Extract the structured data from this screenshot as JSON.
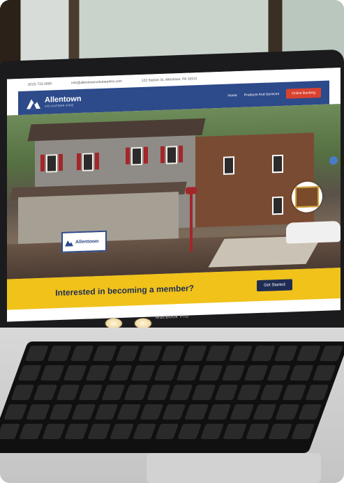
{
  "site": {
    "contact": {
      "phone": "(610) 733-2600",
      "email": "info@allentownvolunteerfire.com",
      "address": "123 Station St, Allentown, PA 18101"
    },
    "logo": {
      "title": "Allentown",
      "subtitle": "VOLUNTEER FIRE"
    },
    "nav": {
      "items": [
        "Home",
        "Products And Services"
      ],
      "cta": "Online Banking"
    },
    "sign_text": "Allentown",
    "banner": {
      "text": "Interested in becoming a member?",
      "button": "Get Started"
    }
  },
  "device": {
    "brand": "MacBook Pro"
  },
  "colors": {
    "nav": "#2d4a8a",
    "cta_red": "#d9422f",
    "banner_yellow": "#f0c21a",
    "navy": "#1f2d55"
  }
}
